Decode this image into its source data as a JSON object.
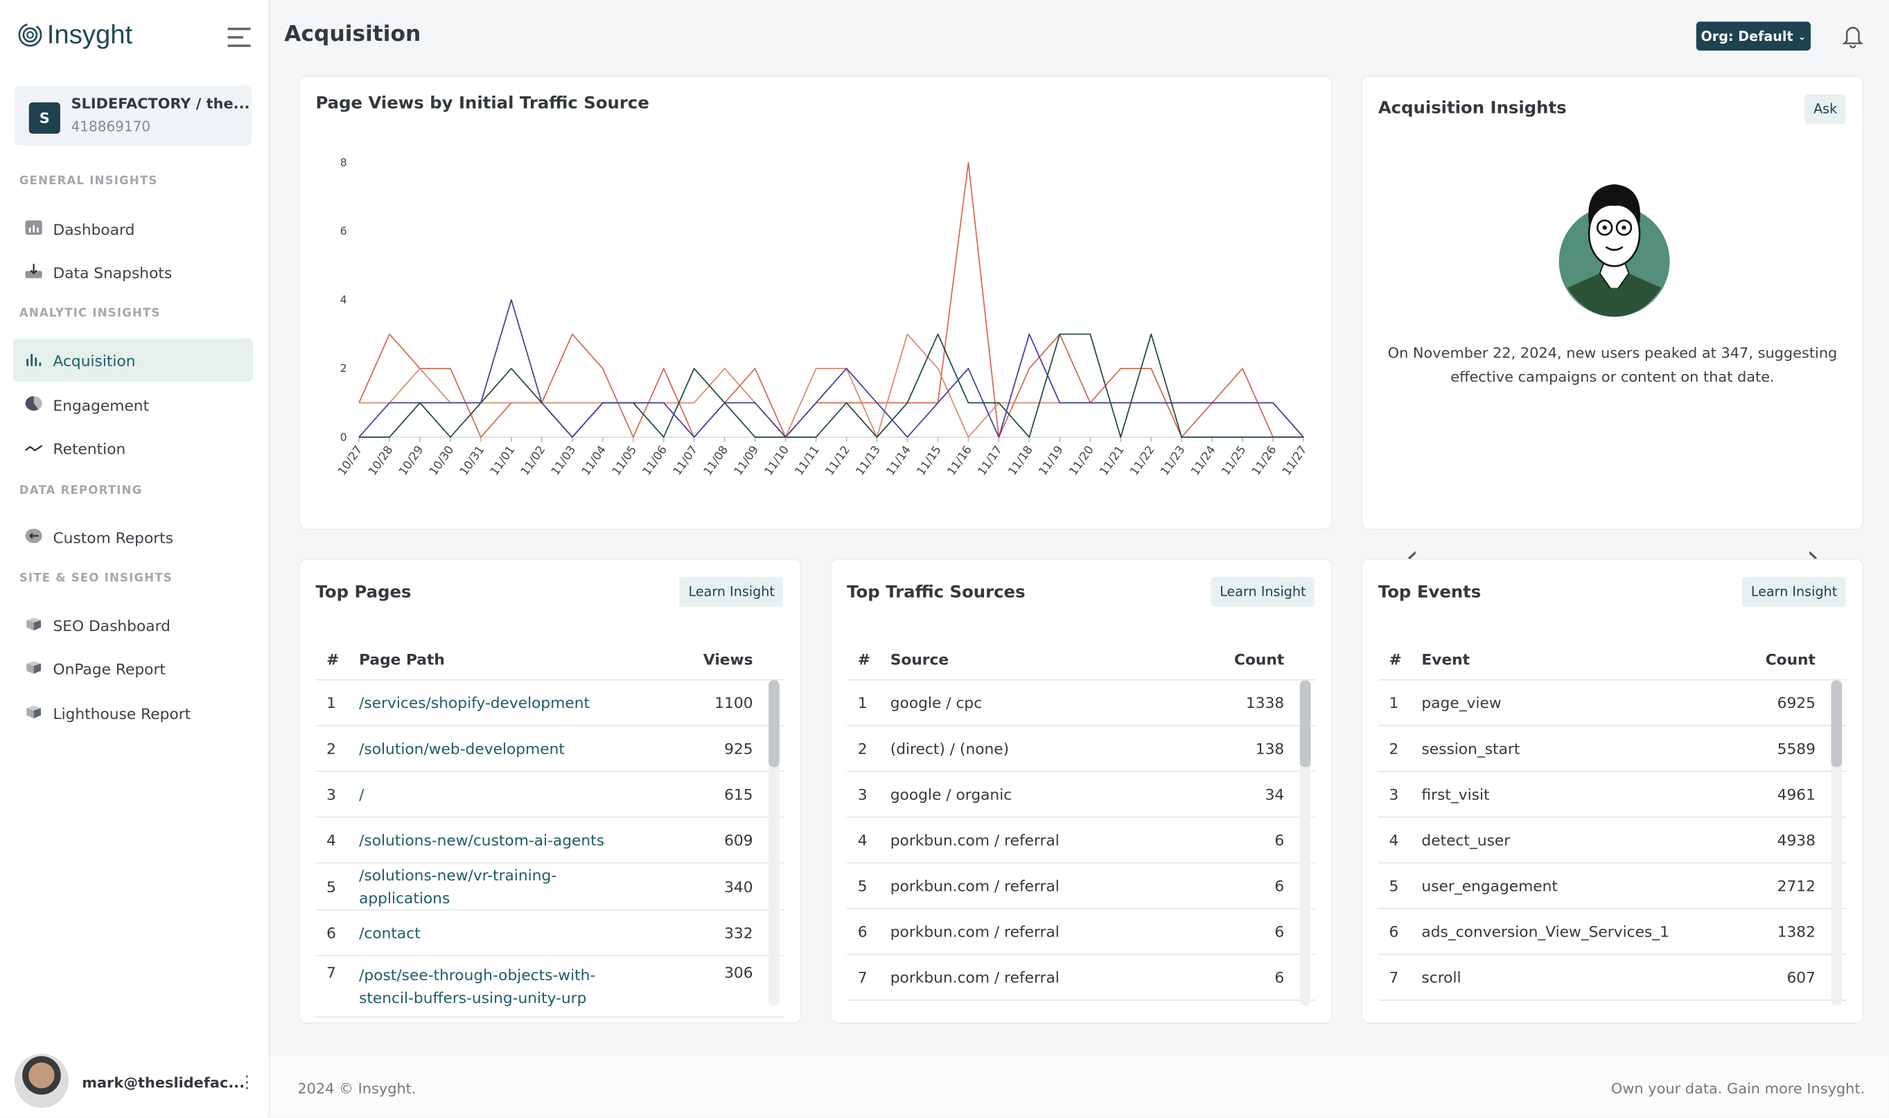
{
  "app": {
    "brand": "Insyght",
    "page_title": "Acquisition",
    "org_button": "Org: Default"
  },
  "org": {
    "initial": "S",
    "name": "SLIDEFACTORY / the...",
    "id": "418869170"
  },
  "sidebar": {
    "sections": [
      {
        "label": "GENERAL INSIGHTS",
        "items": [
          {
            "label": "Dashboard",
            "icon": "bar-chart-icon"
          },
          {
            "label": "Data Snapshots",
            "icon": "download-tray-icon"
          }
        ]
      },
      {
        "label": "ANALYTIC INSIGHTS",
        "items": [
          {
            "label": "Acquisition",
            "icon": "bars-icon",
            "active": true
          },
          {
            "label": "Engagement",
            "icon": "pie-icon"
          },
          {
            "label": "Retention",
            "icon": "trend-icon"
          }
        ]
      },
      {
        "label": "DATA REPORTING",
        "items": [
          {
            "label": "Custom Reports",
            "icon": "arrow-circle-icon"
          }
        ]
      },
      {
        "label": "SITE & SEO INSIGHTS",
        "items": [
          {
            "label": "SEO Dashboard",
            "icon": "cube-icon"
          },
          {
            "label": "OnPage Report",
            "icon": "cube-icon"
          },
          {
            "label": "Lighthouse Report",
            "icon": "cube-icon"
          }
        ]
      }
    ]
  },
  "user": {
    "email": "mark@theslidefac..."
  },
  "chart_card": {
    "title": "Page Views by Initial Traffic Source"
  },
  "chart_data": {
    "type": "line",
    "title": "Page Views by Initial Traffic Source",
    "x": [
      "10/27",
      "10/28",
      "10/29",
      "10/30",
      "10/31",
      "11/01",
      "11/02",
      "11/03",
      "11/04",
      "11/05",
      "11/06",
      "11/07",
      "11/08",
      "11/09",
      "11/10",
      "11/11",
      "11/12",
      "11/13",
      "11/14",
      "11/15",
      "11/16",
      "11/17",
      "11/18",
      "11/19",
      "11/20",
      "11/21",
      "11/22",
      "11/23",
      "11/24",
      "11/25",
      "11/26",
      "11/27"
    ],
    "ylim": [
      0,
      8
    ],
    "yticks": [
      0,
      2,
      4,
      6,
      8
    ],
    "grid": false,
    "series": [
      {
        "color": "#d4694e",
        "values": [
          1,
          3,
          2,
          2,
          0,
          1,
          1,
          3,
          2,
          0,
          2,
          0,
          1,
          2,
          0,
          1,
          1,
          1,
          1,
          1,
          8,
          0,
          2,
          3,
          1,
          2,
          2,
          0,
          1,
          2,
          0,
          0
        ]
      },
      {
        "color": "#d98a6e",
        "values": [
          1,
          1,
          2,
          1,
          1,
          1,
          1,
          1,
          1,
          1,
          1,
          1,
          2,
          1,
          0,
          2,
          2,
          0,
          3,
          2,
          0,
          1,
          1,
          1,
          1,
          1,
          1,
          1,
          1,
          1,
          1,
          0
        ]
      },
      {
        "color": "#1d4a3f",
        "values": [
          0,
          0,
          1,
          0,
          1,
          2,
          1,
          0,
          1,
          1,
          0,
          2,
          1,
          0,
          0,
          0,
          1,
          0,
          1,
          3,
          1,
          1,
          0,
          3,
          3,
          0,
          3,
          0,
          0,
          0,
          0,
          0
        ]
      },
      {
        "color": "#3f3f9e",
        "values": [
          0,
          1,
          1,
          1,
          1,
          4,
          1,
          0,
          1,
          1,
          1,
          0,
          1,
          1,
          0,
          1,
          2,
          1,
          0,
          1,
          2,
          0,
          3,
          1,
          1,
          1,
          1,
          1,
          1,
          1,
          1,
          0
        ]
      }
    ]
  },
  "insights": {
    "title": "Acquisition Insights",
    "ask": "Ask",
    "text": "On November 22, 2024, new users peaked at 347, suggesting effective campaigns or content on that date.",
    "prev": "‹",
    "next": "›"
  },
  "top_pages": {
    "title": "Top Pages",
    "button": "Learn Insight",
    "headers": [
      "#",
      "Page Path",
      "Views"
    ],
    "rows": [
      [
        "1",
        "/services/shopify-development",
        "1100"
      ],
      [
        "2",
        "/solution/web-development",
        "925"
      ],
      [
        "3",
        "/",
        "615"
      ],
      [
        "4",
        "/solutions-new/custom-ai-agents",
        "609"
      ],
      [
        "5",
        "/solutions-new/vr-training-applications",
        "340"
      ],
      [
        "6",
        "/contact",
        "332"
      ],
      [
        "7",
        "/post/see-through-objects-with-stencil-buffers-using-unity-urp",
        "306"
      ]
    ]
  },
  "top_sources": {
    "title": "Top Traffic Sources",
    "button": "Learn Insight",
    "headers": [
      "#",
      "Source",
      "Count"
    ],
    "rows": [
      [
        "1",
        "google / cpc",
        "1338"
      ],
      [
        "2",
        "(direct) / (none)",
        "138"
      ],
      [
        "3",
        "google / organic",
        "34"
      ],
      [
        "4",
        "porkbun.com / referral",
        "6"
      ],
      [
        "5",
        "porkbun.com / referral",
        "6"
      ],
      [
        "6",
        "porkbun.com / referral",
        "6"
      ],
      [
        "7",
        "porkbun.com / referral",
        "6"
      ]
    ]
  },
  "top_events": {
    "title": "Top Events",
    "button": "Learn Insight",
    "headers": [
      "#",
      "Event",
      "Count"
    ],
    "rows": [
      [
        "1",
        "page_view",
        "6925"
      ],
      [
        "2",
        "session_start",
        "5589"
      ],
      [
        "3",
        "first_visit",
        "4961"
      ],
      [
        "4",
        "detect_user",
        "4938"
      ],
      [
        "5",
        "user_engagement",
        "2712"
      ],
      [
        "6",
        "ads_conversion_View_Services_1",
        "1382"
      ],
      [
        "7",
        "scroll",
        "607"
      ]
    ]
  },
  "footer": {
    "left": "2024 © Insyght.",
    "right": "Own your data. Gain more Insyght."
  }
}
